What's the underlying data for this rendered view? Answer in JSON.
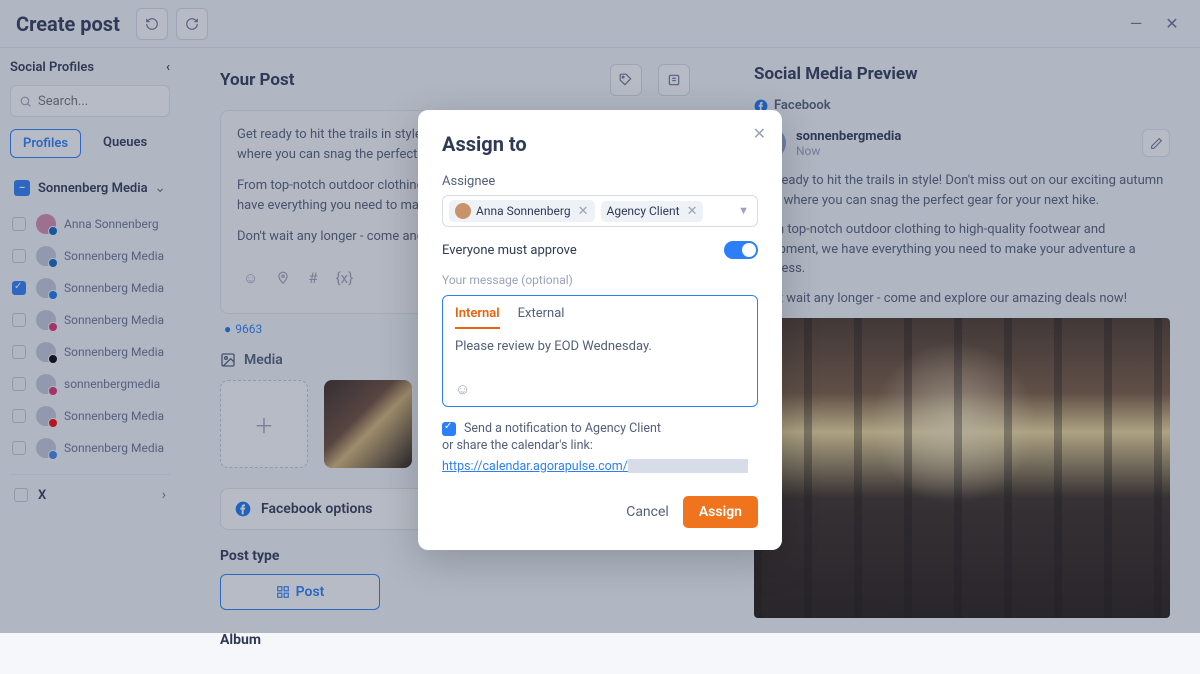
{
  "header": {
    "title": "Create post"
  },
  "sidebar": {
    "label": "Social Profiles",
    "search_placeholder": "Search...",
    "tab_profiles": "Profiles",
    "tab_queues": "Queues",
    "org_name": "Sonnenberg Media",
    "profiles": [
      {
        "name": "Anna Sonnenberg",
        "checked": false,
        "badge": "li",
        "pink": true
      },
      {
        "name": "Sonnenberg Media",
        "checked": false,
        "badge": "li",
        "pink": false
      },
      {
        "name": "Sonnenberg Media",
        "checked": true,
        "badge": "fb",
        "pink": false
      },
      {
        "name": "Sonnenberg Media",
        "checked": false,
        "badge": "ig",
        "pink": false
      },
      {
        "name": "Sonnenberg Media",
        "checked": false,
        "badge": "tt",
        "pink": false
      },
      {
        "name": "sonnenbergmedia",
        "checked": false,
        "badge": "ig",
        "pink": false
      },
      {
        "name": "Sonnenberg Media",
        "checked": false,
        "badge": "yt",
        "pink": false
      },
      {
        "name": "Sonnenberg Media",
        "checked": false,
        "badge": "gb",
        "pink": false
      }
    ],
    "x_label": "X"
  },
  "main": {
    "title": "Your Post",
    "post_p1": "Get ready to hit the trails in style! Don't miss out on our exciting autumn sale, where you can snag the perfect gear for your next hike.",
    "post_p2": "From top-notch outdoor clothing to high-quality footwear and equipment, we have everything you need to make your adventure a success.",
    "post_p3": "Don't wait any longer - come and explore our amazing deals now!",
    "char_count": "9663",
    "media_label": "Media",
    "fb_options": "Facebook options",
    "post_type_label": "Post type",
    "post_type_btn": "Post",
    "album_label": "Album"
  },
  "preview": {
    "title": "Social Media Preview",
    "platform": "Facebook",
    "account": "sonnenbergmedia",
    "time": "Now",
    "p1": "Get ready to hit the trails in style! Don't miss out on our exciting autumn sale, where you can snag the perfect gear for your next hike.",
    "p2": "From top-notch outdoor clothing to high-quality footwear and equipment, we have everything you need to make your adventure a success.",
    "p3": "Don't wait any longer - come and explore our amazing deals now!"
  },
  "modal": {
    "title": "Assign to",
    "assignee_label": "Assignee",
    "chip1": "Anna Sonnenberg",
    "chip2": "Agency Client",
    "approve_label": "Everyone must approve",
    "message_label": "Your message (optional)",
    "tab_internal": "Internal",
    "tab_external": "External",
    "message_text": "Please review by EOD Wednesday.",
    "notify_text": "Send a notification to Agency Client",
    "share_text": "or share the calendar's link:",
    "share_url": "https://calendar.agorapulse.com/",
    "cancel": "Cancel",
    "assign": "Assign"
  }
}
